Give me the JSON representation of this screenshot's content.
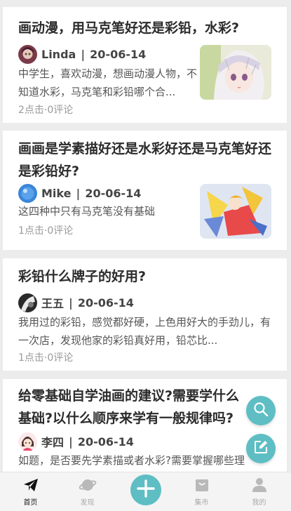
{
  "feed": [
    {
      "title": "画动漫，用马克笔好还是彩铅，水彩?",
      "author": "Linda",
      "date": "20-06-14",
      "excerpt": "中学生，喜欢动漫，想画动漫人物，不知道水彩，马克笔和彩铅哪个合...",
      "stats": "2点击·0评论",
      "thumb_icon": "anime-girl-drawing-image",
      "avatar_icon": "avatar-anime-icon"
    },
    {
      "title": "画画是学素描好还是水彩好还是马克笔好还是彩铅好?",
      "author": "Mike",
      "date": "20-06-14",
      "excerpt": "这四种中只有马克笔没有基础",
      "stats": "1点击·0评论",
      "thumb_icon": "anime-character-drawing-image",
      "avatar_icon": "avatar-blue-icon"
    },
    {
      "title": "彩铅什么牌子的好用?",
      "author": "王五",
      "date": "20-06-14",
      "excerpt": "我用过的彩铅，感觉都好硬，上色用好大的手劲儿，有一次店，发现他家的彩铅真好用，铅芯比...",
      "stats": "1点击·0评论",
      "avatar_icon": "avatar-dark-icon"
    },
    {
      "title": "给零基础自学油画的建议?需要学什么基础?以什么顺序来学有一般规律吗?",
      "author": "李四",
      "date": "20-06-14",
      "excerpt": "如题，是否要先学素描或者水彩?需要掌握哪些理",
      "avatar_icon": "avatar-cartoon-girl-icon"
    }
  ],
  "separator": "|",
  "tabs": [
    {
      "label": "首页",
      "icon": "paper-plane-icon"
    },
    {
      "label": "发现",
      "icon": "planet-icon"
    },
    {
      "label": "",
      "icon": "plus-icon"
    },
    {
      "label": "集市",
      "icon": "shopping-bag-icon"
    },
    {
      "label": "我的",
      "icon": "person-icon"
    }
  ],
  "colors": {
    "accent": "#5ebec4",
    "background": "#ececec",
    "card": "#ffffff",
    "title": "#2b2b2b",
    "muted": "#999999"
  }
}
